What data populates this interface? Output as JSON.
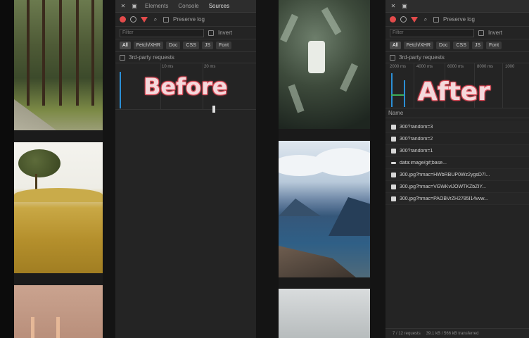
{
  "labels": {
    "before": "Before",
    "after": "After"
  },
  "devtools": {
    "tabs": [
      "Elements",
      "Console",
      "Sources"
    ],
    "preserve_log": "Preserve log",
    "filter_placeholder": "Filter",
    "invert": "Invert",
    "types": [
      "All",
      "Fetch/XHR",
      "Doc",
      "CSS",
      "JS",
      "Font"
    ],
    "third_party": "3rd-party requests",
    "ticks_before": [
      "10 ms",
      "20 ms"
    ],
    "ticks_after": [
      "2000 ms",
      "4000 ms",
      "6000 ms",
      "8000 ms",
      "1000"
    ],
    "name_header": "Name",
    "requests": [
      "300?random=3",
      "300?random=2",
      "300?random=1",
      "data:image/gif;base...",
      "300.jpg?hmac=HWbRBUP0Wz2ygsD7I...",
      "300.jpg?hmac=VGWKvlJOWTKZbZIY...",
      "300.jpg?hmac=PAOBVrZH2785I14vvw..."
    ],
    "status": [
      "7 / 12 requests",
      "39.1 kB / 566 kB transferred"
    ]
  },
  "colors": {
    "label_glow": "#e0525f",
    "record": "#e34b4b",
    "timeline_bar": "#2b8fd6"
  }
}
